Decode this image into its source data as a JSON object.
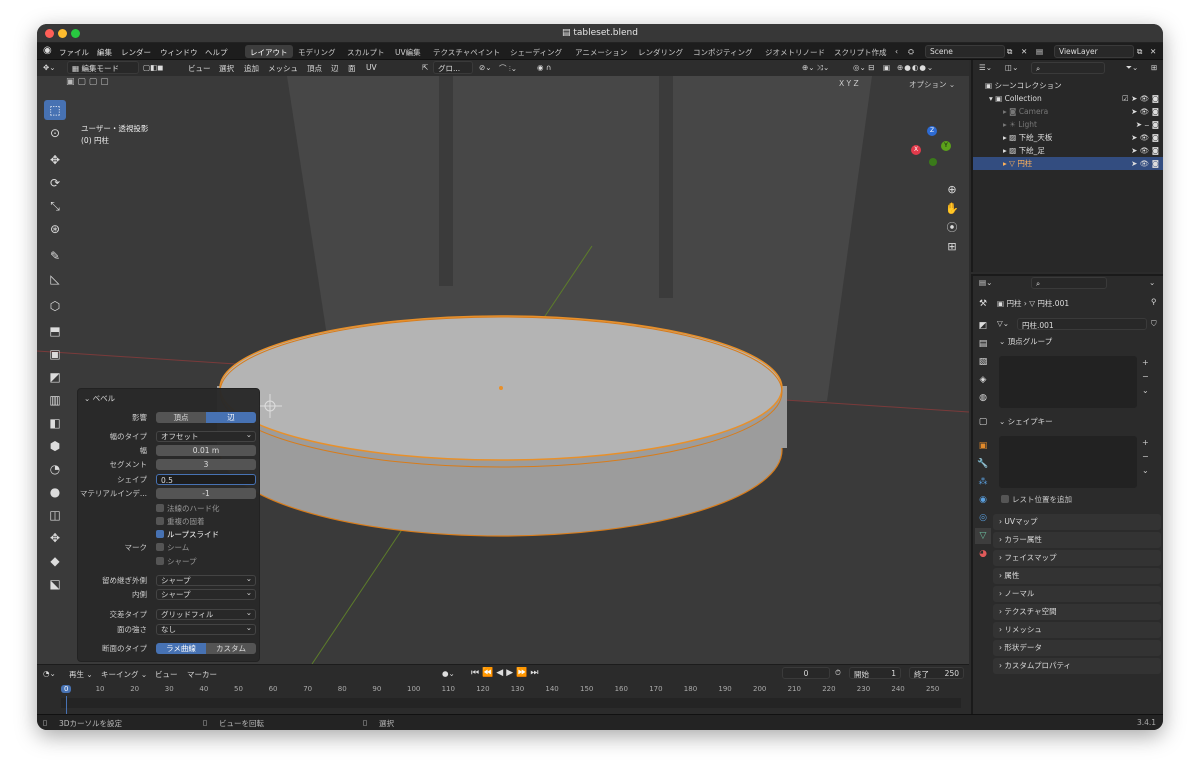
{
  "window": {
    "title": "tableset.blend"
  },
  "menus": [
    "ファイル",
    "編集",
    "レンダー",
    "ウィンドウ",
    "ヘルプ"
  ],
  "workspaces": [
    "レイアウト",
    "モデリング",
    "スカルプト",
    "UV編集",
    "テクスチャペイント",
    "シェーディング",
    "アニメーション",
    "レンダリング",
    "コンポジティング",
    "ジオメトリノード",
    "スクリプト作成"
  ],
  "scene": {
    "name": "Scene",
    "view_layer": "ViewLayer"
  },
  "header3d": {
    "mode": "編集モード",
    "menus": [
      "ビュー",
      "選択",
      "追加",
      "メッシュ",
      "頂点",
      "辺",
      "面",
      "UV"
    ],
    "transform": "グロ...",
    "overlay_options": "オプション",
    "axes": [
      "X",
      "Y",
      "Z"
    ]
  },
  "viewport": {
    "view_name": "ユーザー・透視投影",
    "object_label": "(0) 円柱",
    "navigator": [
      "X",
      "Y",
      "Z"
    ]
  },
  "operator": {
    "title": "ベベル",
    "affect": {
      "label": "影響",
      "options": [
        "頂点",
        "辺"
      ],
      "selected": "辺"
    },
    "width_type": {
      "label": "幅のタイプ",
      "value": "オフセット"
    },
    "width": {
      "label": "幅",
      "value": "0.01 m"
    },
    "segments": {
      "label": "セグメント",
      "value": "3"
    },
    "shape": {
      "label": "シェイプ",
      "value": "0.5"
    },
    "material_index": {
      "label": "マテリアルインデ...",
      "value": "-1"
    },
    "checks": [
      {
        "label": "法線のハード化",
        "checked": false
      },
      {
        "label": "重複の固着",
        "checked": false
      },
      {
        "label": "ループスライド",
        "checked": true
      }
    ],
    "mark": {
      "label": "マーク",
      "items": [
        {
          "label": "シーム",
          "checked": false
        },
        {
          "label": "シャープ",
          "checked": false
        }
      ]
    },
    "miter_outer": {
      "label": "留め継ぎ外側",
      "value": "シャープ"
    },
    "miter_inner": {
      "label": "内側",
      "value": "シャープ"
    },
    "intersection": {
      "label": "交差タイプ",
      "value": "グリッドフィル"
    },
    "face_strength": {
      "label": "面の強さ",
      "value": "なし"
    },
    "profile_type": {
      "label": "断面のタイプ",
      "options": [
        "ラメ曲線",
        "カスタム"
      ],
      "selected": "ラメ曲線"
    }
  },
  "outliner": {
    "root": "シーンコレクション",
    "collection": "Collection",
    "items": [
      {
        "name": "Camera",
        "dim": true
      },
      {
        "name": "Light",
        "dim": true
      },
      {
        "name": "下絵_天板",
        "dim": false
      },
      {
        "name": "下絵_足",
        "dim": false
      },
      {
        "name": "円柱",
        "dim": false,
        "selected": true
      }
    ]
  },
  "properties": {
    "object": "円柱",
    "mesh": "円柱.001",
    "mesh_field": "円柱.001",
    "vertex_groups": "頂点グループ",
    "shape_keys": "シェイプキー",
    "relative": "レスト位置を追加",
    "sections": [
      "UVマップ",
      "カラー属性",
      "フェイスマップ",
      "属性",
      "ノーマル",
      "テクスチャ空間",
      "リメッシュ",
      "形状データ",
      "カスタムプロパティ"
    ]
  },
  "timeline": {
    "menus": [
      "再生",
      "キーイング",
      "ビュー",
      "マーカー"
    ],
    "current": "0",
    "start_label": "開始",
    "start": "1",
    "end_label": "終了",
    "end": "250",
    "ticks": [
      "0",
      "10",
      "20",
      "30",
      "40",
      "50",
      "60",
      "70",
      "80",
      "90",
      "100",
      "110",
      "120",
      "130",
      "140",
      "150",
      "160",
      "170",
      "180",
      "190",
      "200",
      "210",
      "220",
      "230",
      "240",
      "250"
    ]
  },
  "status": {
    "items": [
      "3Dカーソルを設定",
      "ビューを回転",
      "選択"
    ],
    "version": "3.4.1"
  }
}
